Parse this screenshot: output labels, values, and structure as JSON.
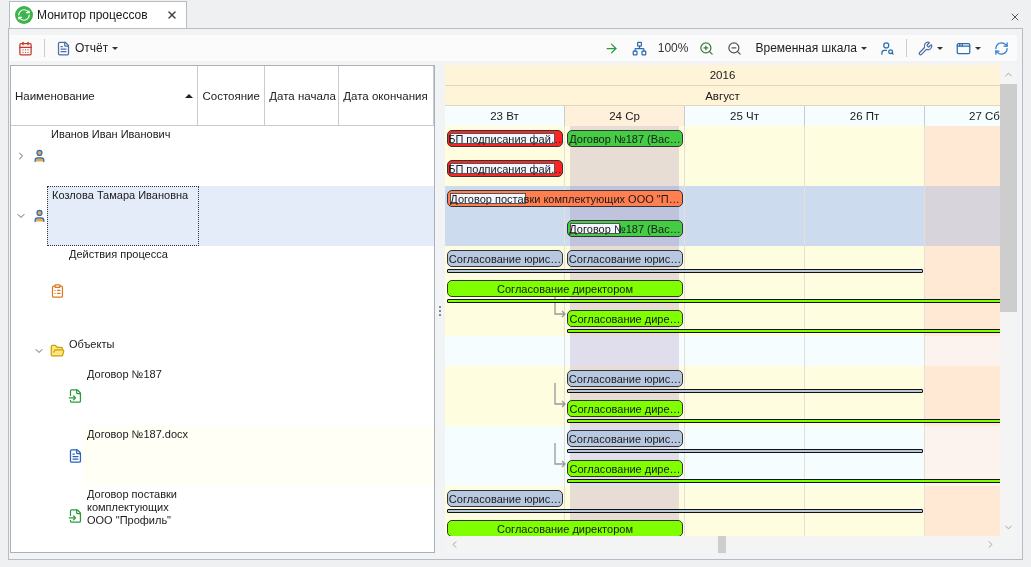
{
  "tab": {
    "title": "Монитор процессов",
    "selected": true
  },
  "toolbar": {
    "left": [
      {
        "kind": "icon"
      },
      {
        "kind": "divider"
      },
      {
        "kind": "menu",
        "label": "Отчёт"
      }
    ],
    "right": [
      {
        "kind": "icon"
      },
      {
        "kind": "icon"
      },
      {
        "kind": "text",
        "label": "100%"
      },
      {
        "kind": "icon"
      },
      {
        "kind": "icon"
      },
      {
        "kind": "menu",
        "label": "Временная шкала"
      },
      {
        "kind": "icon"
      },
      {
        "kind": "divider"
      },
      {
        "kind": "menu"
      },
      {
        "kind": "menu"
      },
      {
        "kind": "icon"
      }
    ]
  },
  "columns": [
    {
      "label": "Наименование",
      "sorted": true
    },
    {
      "label": "Состояние",
      "sorted": false
    },
    {
      "label": "Дата начала",
      "sorted": false
    },
    {
      "label": "Дата окончания",
      "sorted": false
    }
  ],
  "timeline": {
    "year": "2016",
    "month": "Август",
    "days": [
      {
        "label": "23 Вт",
        "weekend": false,
        "highlighted": false
      },
      {
        "label": "24 Ср",
        "weekend": false,
        "highlighted": true
      },
      {
        "label": "25 Чт",
        "weekend": false,
        "highlighted": false
      },
      {
        "label": "26 Пт",
        "weekend": false,
        "highlighted": false
      },
      {
        "label": "27 Сб",
        "weekend": true,
        "highlighted": false
      }
    ]
  },
  "tree": [
    {
      "name": "Иванов Иван Иванович",
      "kind": "person",
      "expanded": false,
      "selected": false,
      "lanes": [
        {
          "on_first_day": {
            "label": "БП подписания фай…",
            "color": "#ff2424",
            "spans_two_days": false,
            "level": 0.96
          },
          "on_second_day": {
            "label": "Договор №187 (Вас…",
            "color": "#44cc44",
            "spans_two_days": false
          }
        },
        {
          "on_first_day": {
            "label": "БП подписания фай…",
            "color": "#ff2424",
            "spans_two_days": false,
            "level": 0.96
          }
        }
      ]
    },
    {
      "name": "Козлова Тамара Ивановна",
      "kind": "person",
      "expanded": true,
      "selected": true,
      "lanes": [
        {
          "on_first_day": {
            "label": "Договор поставки комплектующих ООО \"П…",
            "color": "#ff7f50",
            "spans_two_days": true,
            "level": 0.34
          }
        },
        {
          "on_second_day": {
            "label": "Договор №187 (Вас…",
            "color": "#44cc44",
            "spans_two_days": false,
            "level": 0.47
          }
        }
      ],
      "children": [
        {
          "name": "Действия процесса",
          "kind": "process",
          "selected": false,
          "lanes": [
            {
              "on_first_day": {
                "label": "Согласование юрис…",
                "color": "#b8c8e0",
                "spans_two_days": false
              },
              "on_second_day": {
                "label": "Согласование юрис…",
                "color": "#b8c8e0",
                "spans_two_days": false
              },
              "baseline": {
                "color": "#b8c8dc",
                "past_edge": false
              }
            },
            {
              "on_first_day": {
                "label": "Согласование директором",
                "color": "#80ff00",
                "spans_two_days": true
              },
              "baseline": {
                "color": "#80ff00",
                "past_edge": true
              }
            },
            {
              "on_second_day": {
                "label": "Согласование дире…",
                "color": "#80ff00",
                "spans_two_days": false,
                "arrow_in": true
              },
              "baseline": {
                "color": "#80ff00",
                "past_edge": true
              }
            }
          ]
        },
        {
          "name": "Объекты",
          "kind": "folder",
          "expanded": true,
          "selected": false,
          "children": [
            {
              "name": "Договор №187",
              "kind": "document",
              "selected": false,
              "lanes": [
                {
                  "on_second_day": {
                    "label": "Согласование юрис…",
                    "color": "#b8c8e0",
                    "spans_two_days": false
                  },
                  "baseline": {
                    "color": "#b8c8dc",
                    "past_edge": false
                  }
                },
                {
                  "on_second_day": {
                    "label": "Согласование дире…",
                    "color": "#80ff00",
                    "spans_two_days": false,
                    "arrow_in": true
                  },
                  "baseline": {
                    "color": "#80ff00",
                    "past_edge": true
                  }
                }
              ]
            },
            {
              "name": "Договор №187.docx",
              "kind": "word",
              "selected": false,
              "lanes": [
                {
                  "on_second_day": {
                    "label": "Согласование юрис…",
                    "color": "#b8c8e0",
                    "spans_two_days": false
                  },
                  "baseline": {
                    "color": "#b8c8dc",
                    "past_edge": false
                  }
                },
                {
                  "on_second_day": {
                    "label": "Согласование дире…",
                    "color": "#80ff00",
                    "spans_two_days": false,
                    "arrow_in": true
                  },
                  "baseline": {
                    "color": "#80ff00",
                    "past_edge": true
                  }
                }
              ]
            },
            {
              "name": "Договор поставки комплектующих ООО \"Профиль\"",
              "kind": "document",
              "selected": false,
              "lanes": [
                {
                  "on_first_day": {
                    "label": "Согласование юрис…",
                    "color": "#b8c8e0",
                    "spans_two_days": false
                  },
                  "baseline": {
                    "color": "#b8c8dc",
                    "past_edge": false
                  }
                },
                {
                  "on_first_day": {
                    "label": "Согласование директором",
                    "color": "#80ff00",
                    "spans_two_days": true
                  }
                }
              ]
            }
          ]
        }
      ]
    }
  ]
}
